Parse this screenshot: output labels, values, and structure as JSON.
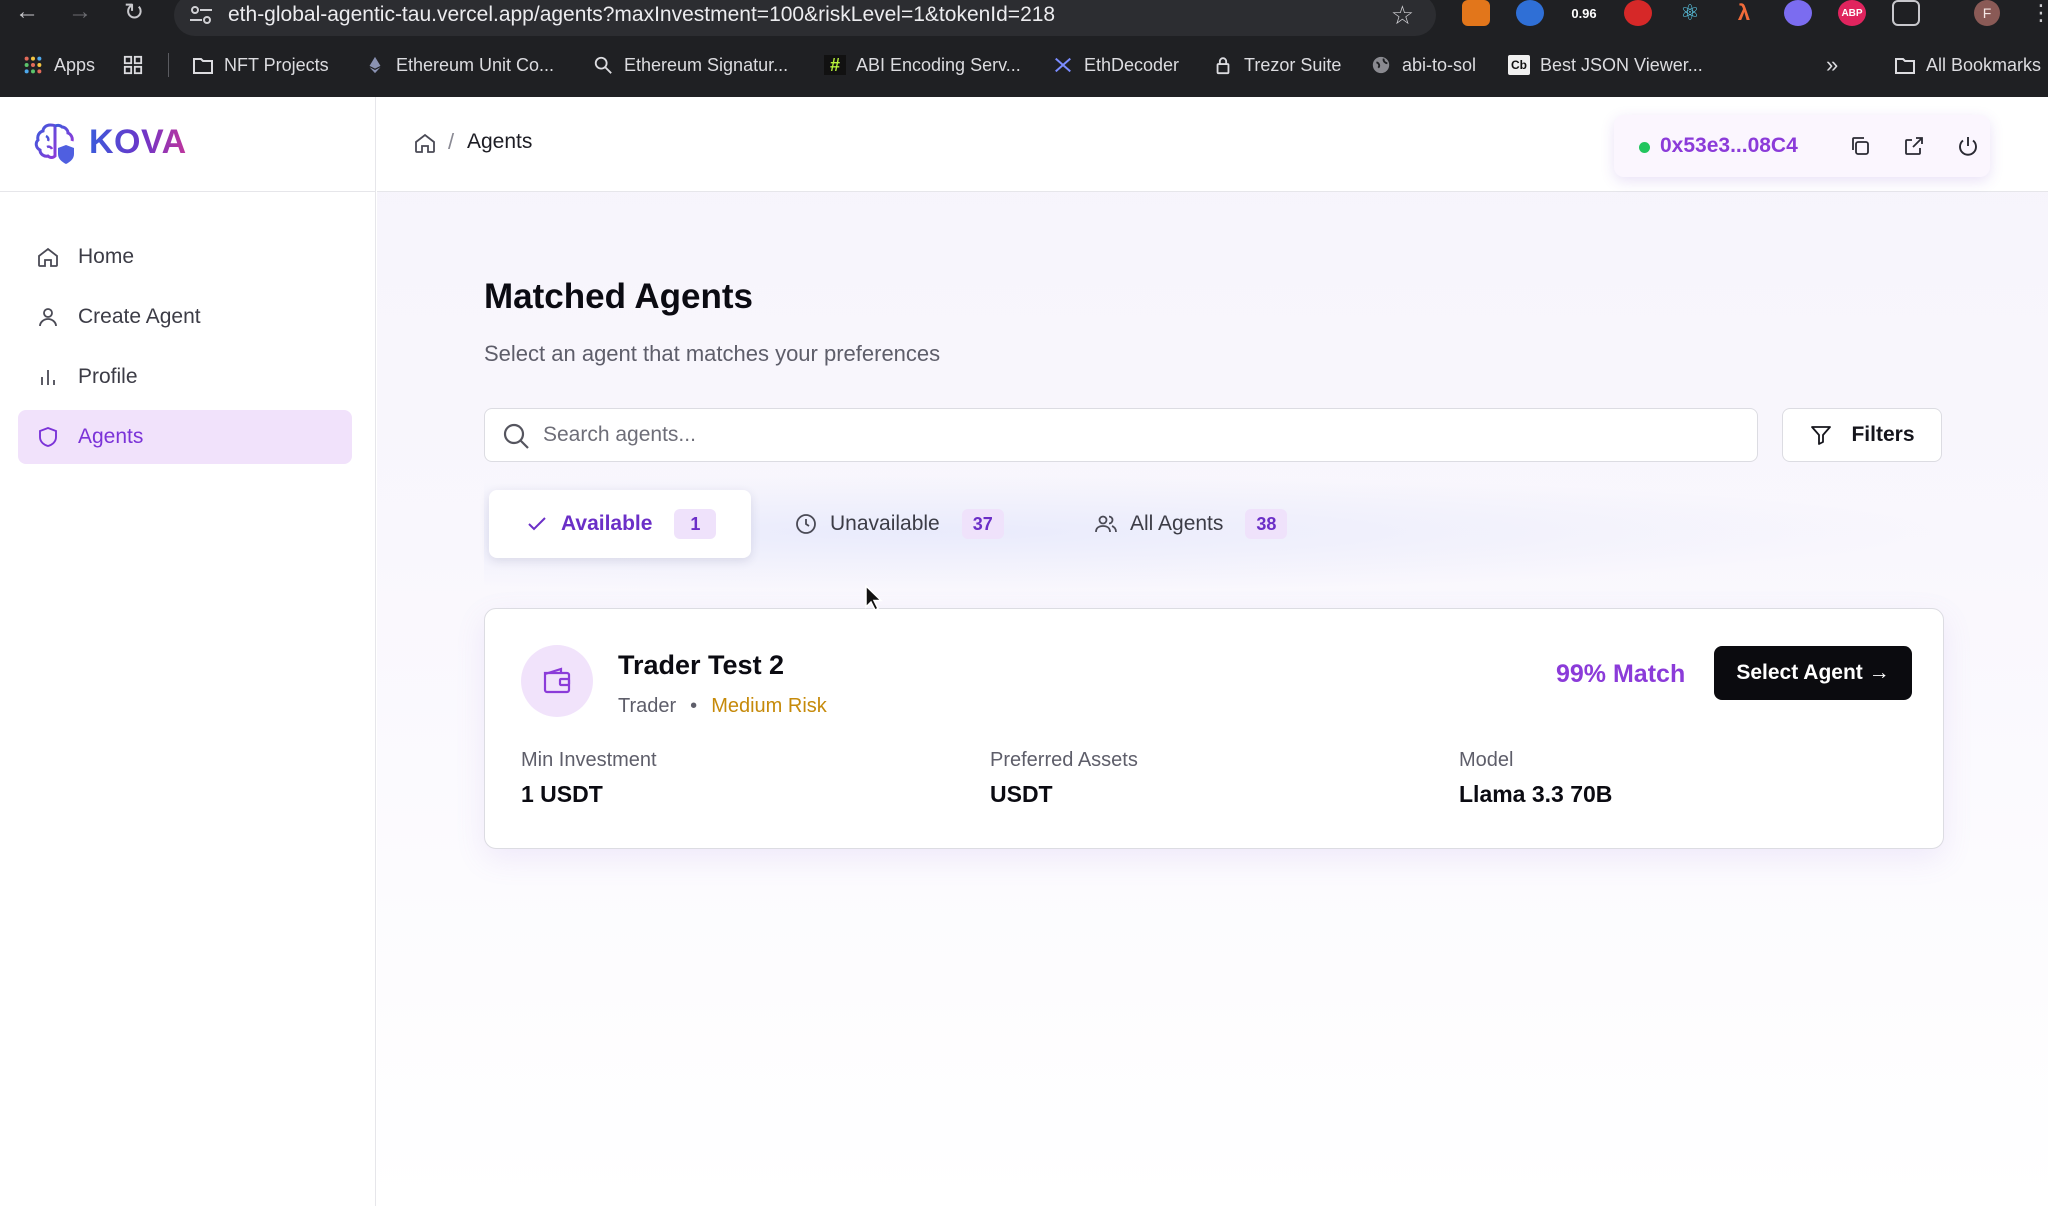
{
  "browser": {
    "url": "eth-global-agentic-tau.vercel.app/agents?maxInvestment=100&riskLevel=1&tokenId=218",
    "extension_badge": "0.96",
    "ext_abp": "ABP",
    "profile_initial": "F",
    "bookmarks": [
      {
        "label": "Apps"
      },
      {
        "label": "NFT Projects"
      },
      {
        "label": "Ethereum Unit Co..."
      },
      {
        "label": "Ethereum Signatur..."
      },
      {
        "label": "ABI Encoding Serv..."
      },
      {
        "label": "EthDecoder"
      },
      {
        "label": "Trezor Suite"
      },
      {
        "label": "abi-to-sol"
      },
      {
        "label": "Best JSON Viewer..."
      }
    ],
    "more_bookmarks": "»",
    "all_bookmarks": "All Bookmarks",
    "bm_cb": "Cb",
    "bm_hash": "#"
  },
  "app": {
    "brand": "KOVA",
    "nav": [
      {
        "label": "Home",
        "icon": "home-icon",
        "active": false
      },
      {
        "label": "Create Agent",
        "icon": "user-icon",
        "active": false
      },
      {
        "label": "Profile",
        "icon": "bar-chart-icon",
        "active": false
      },
      {
        "label": "Agents",
        "icon": "shield-icon",
        "active": true
      }
    ],
    "breadcrumb": {
      "separator": "/",
      "current": "Agents"
    },
    "wallet": {
      "address": "0x53e3...08C4",
      "status_color": "#22c55e"
    }
  },
  "page": {
    "title": "Matched Agents",
    "subtitle": "Select an agent that matches your preferences",
    "search_placeholder": "Search agents...",
    "filters_label": "Filters",
    "tabs": [
      {
        "label": "Available",
        "count": "1",
        "active": true
      },
      {
        "label": "Unavailable",
        "count": "37",
        "active": false
      },
      {
        "label": "All Agents",
        "count": "38",
        "active": false
      }
    ],
    "agents": [
      {
        "name": "Trader Test 2",
        "type": "Trader",
        "bullet": "•",
        "risk": "Medium Risk",
        "match": "99% Match",
        "select_label": "Select Agent →",
        "stats": [
          {
            "label": "Min Investment",
            "value": "1 USDT"
          },
          {
            "label": "Preferred Assets",
            "value": "USDT"
          },
          {
            "label": "Model",
            "value": "Llama 3.3 70B"
          }
        ]
      }
    ]
  },
  "colors": {
    "accent": "#8b3bd9",
    "active_nav_bg": "#f1e2fb",
    "risk_medium": "#c68a0a",
    "primary_button": "#0b0b0f"
  }
}
